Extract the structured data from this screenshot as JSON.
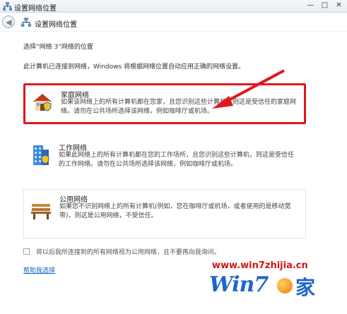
{
  "window": {
    "title": "设置网络位置",
    "minimize": "—",
    "maximize": "□",
    "close": "✕"
  },
  "nav": {
    "title": "设置网络位置",
    "back_icon": "back-arrow-icon"
  },
  "instruction": "选择“网络 3”网络的位置",
  "explain": "此计算机已连接到网络，Windows 将根据网络位置自动应用正确的网络设置。",
  "options": [
    {
      "title": "家庭网络",
      "desc": "如果该网络上的所有计算机都在您家，且您识别这些计算机，则这是受信任的家庭网络。请勿在公共场所选择该网络，例如咖啡厅或机场。",
      "icon": "house-icon"
    },
    {
      "title": "工作网络",
      "desc": "如果此网络上的所有计算机都在您的工作场所，且您识别这些计算机，则这是受信任的工作网络。请勿在公共场所选择该网络，例如咖啡厅或机场。",
      "icon": "office-building-icon"
    },
    {
      "title": "公用网络",
      "desc": "如果您不识别网络上的所有计算机(例如，您在咖啡厅或机场，或者使用的是移动宽带)，则这是公用网络，不受信任。",
      "icon": "park-bench-icon"
    }
  ],
  "checkbox_label": "将以后我所连接到的所有网络视为公用网络，且不要再向我询问。",
  "help_link": "帮助我选择",
  "watermark": {
    "url": "www.win7zhijia.cn",
    "logo_text": "Win7",
    "logo_char": "家"
  },
  "colors": {
    "highlight": "#e0181e",
    "link": "#1064c0",
    "watermark_red": "#d01616",
    "watermark_blue": "#1f66c9"
  }
}
